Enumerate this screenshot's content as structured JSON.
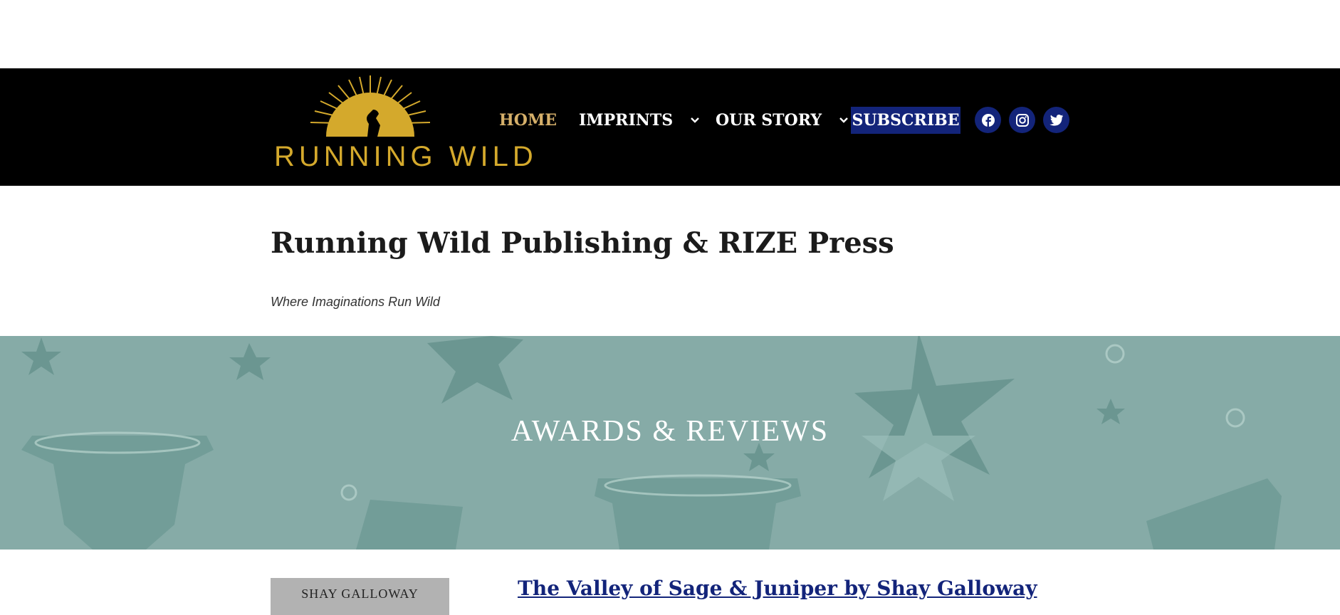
{
  "brand": {
    "logo_text": "RUNNING WILD",
    "accent_color": "#d4a92c"
  },
  "nav": {
    "items": [
      {
        "label": "HOME",
        "active": true
      },
      {
        "label": "IMPRINTS",
        "has_dropdown": true
      },
      {
        "label": "OUR STORY",
        "has_dropdown": true
      }
    ],
    "subscribe_label": "SUBSCRIBE",
    "social_icons": [
      "facebook-icon",
      "instagram-icon",
      "twitter-icon"
    ],
    "nav_color": "#13247a"
  },
  "site": {
    "title": "Running Wild Publishing & RIZE Press",
    "tagline": "Where Imaginations Run Wild"
  },
  "hero": {
    "title": "AWARDS & REVIEWS",
    "bg_color": "#86aba7"
  },
  "post": {
    "cover_text": "SHAY GALLOWAY",
    "title": "The Valley of Sage & Juniper by Shay Galloway"
  }
}
